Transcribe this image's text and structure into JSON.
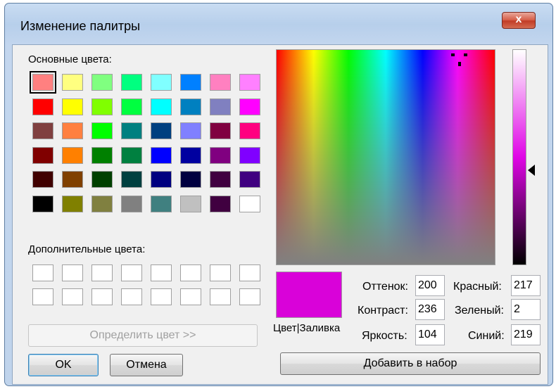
{
  "window": {
    "title": "Изменение палитры",
    "close_glyph": "x"
  },
  "basic_colors": {
    "label": "Основные цвета:",
    "selected_index": 0,
    "swatches": [
      "#ff8080",
      "#ffff80",
      "#80ff80",
      "#00ff80",
      "#80ffff",
      "#0080ff",
      "#ff80c0",
      "#ff80ff",
      "#ff0000",
      "#ffff00",
      "#80ff00",
      "#00ff40",
      "#00ffff",
      "#0080c0",
      "#8080c0",
      "#ff00ff",
      "#804040",
      "#ff8040",
      "#00ff00",
      "#008080",
      "#004080",
      "#8080ff",
      "#800040",
      "#ff0080",
      "#800000",
      "#ff8000",
      "#008000",
      "#008040",
      "#0000ff",
      "#0000a0",
      "#800080",
      "#8000ff",
      "#400000",
      "#804000",
      "#004000",
      "#004040",
      "#000080",
      "#000040",
      "#400040",
      "#400080",
      "#000000",
      "#808000",
      "#808040",
      "#808080",
      "#408080",
      "#c0c0c0",
      "#400040",
      "#ffffff"
    ]
  },
  "custom_colors": {
    "label": "Дополнительные цвета:",
    "swatches": [
      "#ffffff",
      "#ffffff",
      "#ffffff",
      "#ffffff",
      "#ffffff",
      "#ffffff",
      "#ffffff",
      "#ffffff",
      "#ffffff",
      "#ffffff",
      "#ffffff",
      "#ffffff",
      "#ffffff",
      "#ffffff",
      "#ffffff",
      "#ffffff"
    ]
  },
  "define_button": "Определить цвет >>",
  "ok_button": "OK",
  "cancel_button": "Отмена",
  "preview": {
    "label": "Цвет|Заливка",
    "color": "#d902d9"
  },
  "fields": {
    "hue_label": "Оттенок:",
    "hue": "200",
    "sat_label": "Контраст:",
    "sat": "236",
    "lum_label": "Яркость:",
    "lum": "104",
    "red_label": "Красный:",
    "red": "217",
    "green_label": "Зеленый:",
    "green": "2",
    "blue_label": "Синий:",
    "blue": "219"
  },
  "add_button": "Добавить в набор"
}
